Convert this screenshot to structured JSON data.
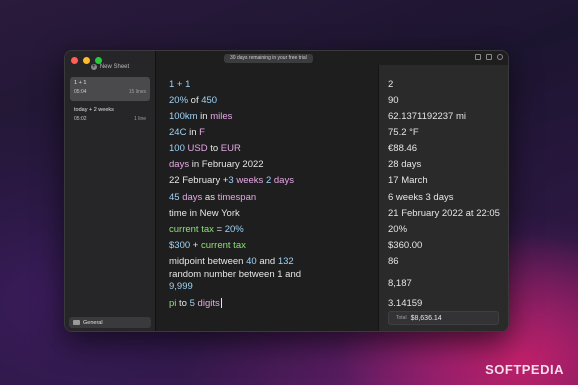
{
  "sidebar": {
    "new_sheet_label": "New Sheet",
    "sheets": [
      {
        "title": "1 + 1",
        "time": "05:04",
        "lines": "15 lines"
      },
      {
        "title": "today + 2 weeks",
        "time": "05:02",
        "lines": "1 line"
      }
    ],
    "category": "General"
  },
  "titlebar": {
    "trial_text": "30 days remaining in your free trial"
  },
  "editor": {
    "lines": [
      [
        {
          "t": "1 + 1",
          "c": "num"
        }
      ],
      [
        {
          "t": "20%",
          "c": "num"
        },
        {
          "t": " of ",
          "c": ""
        },
        {
          "t": "450",
          "c": "num"
        }
      ],
      [
        {
          "t": "100km",
          "c": "num"
        },
        {
          "t": " in ",
          "c": ""
        },
        {
          "t": "miles",
          "c": "unit"
        }
      ],
      [
        {
          "t": "24C",
          "c": "num"
        },
        {
          "t": " in ",
          "c": ""
        },
        {
          "t": "F",
          "c": "unit"
        }
      ],
      [
        {
          "t": "100",
          "c": "num"
        },
        {
          "t": " USD",
          "c": "unit"
        },
        {
          "t": " to ",
          "c": ""
        },
        {
          "t": "EUR",
          "c": "unit"
        }
      ],
      [
        {
          "t": "days",
          "c": "unit"
        },
        {
          "t": " in February 2022",
          "c": ""
        }
      ],
      [
        {
          "t": "22 February +",
          "c": ""
        },
        {
          "t": "3",
          "c": "num"
        },
        {
          "t": " weeks ",
          "c": "unit"
        },
        {
          "t": "2",
          "c": "num"
        },
        {
          "t": " days",
          "c": "unit"
        }
      ],
      [
        {
          "t": "45",
          "c": "num"
        },
        {
          "t": " days",
          "c": "unit"
        },
        {
          "t": " as ",
          "c": ""
        },
        {
          "t": "timespan",
          "c": "unit"
        }
      ],
      [
        {
          "t": "time in New York",
          "c": ""
        }
      ],
      [
        {
          "t": "current tax",
          "c": "var"
        },
        {
          "t": " = ",
          "c": ""
        },
        {
          "t": "20%",
          "c": "num"
        }
      ],
      [
        {
          "t": "$300",
          "c": "num"
        },
        {
          "t": " + ",
          "c": ""
        },
        {
          "t": "current tax",
          "c": "var"
        }
      ],
      [
        {
          "t": "midpoint between ",
          "c": ""
        },
        {
          "t": "40",
          "c": "num"
        },
        {
          "t": " and ",
          "c": ""
        },
        {
          "t": "132",
          "c": "num"
        }
      ],
      [
        {
          "t": "random number between 1 and ",
          "c": ""
        },
        {
          "t": "9,999",
          "c": "num"
        }
      ],
      [
        {
          "t": "pi",
          "c": "var"
        },
        {
          "t": " to ",
          "c": ""
        },
        {
          "t": "5",
          "c": "num"
        },
        {
          "t": " digits",
          "c": "unit"
        }
      ]
    ]
  },
  "results": {
    "values": [
      "2",
      "90",
      "62.1371192237 mi",
      "75.2 °F",
      "€88.46",
      "28 days",
      "17 March",
      "6 weeks 3 days",
      "21 February 2022 at 22:05",
      "20%",
      "$360.00",
      "86",
      "8,187",
      "3.14159"
    ],
    "total_label": "Total",
    "total_value": "$8,636.14"
  },
  "watermark": "SOFTPEDIA",
  "colors": {
    "number": "#9ed3f7",
    "unit": "#e6a8e6",
    "variable": "#8fe07a"
  }
}
